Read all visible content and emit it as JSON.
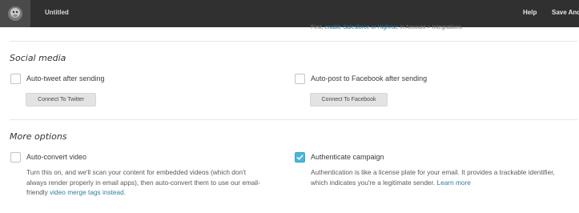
{
  "topbar": {
    "logo": "chimp-logo-icon",
    "title": "Untitled",
    "help_label": "Help",
    "save_label": "Save And"
  },
  "hint": {
    "prefix": "First, ",
    "link": "enable Salesforce or Highrise",
    "suffix": " in Account > Integrations."
  },
  "social": {
    "heading": "Social media",
    "twitter": {
      "checked": false,
      "label": "Auto-tweet after sending",
      "button": "Connect To Twitter"
    },
    "facebook": {
      "checked": false,
      "label": "Auto-post to Facebook after sending",
      "button": "Connect To Facebook"
    }
  },
  "more": {
    "heading": "More options",
    "video": {
      "checked": false,
      "label": "Auto-convert video",
      "desc_line1": "Turn this on, and we'll scan your content for embedded videos (which don't",
      "desc_line2": "always render properly in email apps), then auto-convert them to use our email-",
      "desc_line3_prefix": "friendly ",
      "desc_link": "video merge tags instead."
    },
    "authenticate": {
      "checked": true,
      "label": "Authenticate campaign",
      "desc_line1": "Authentication is like a license plate for your email. It provides a trackable identifier,",
      "desc_line2_prefix": "which indicates you're a legitimate sender. ",
      "desc_link": "Learn more"
    }
  },
  "colors": {
    "topbar_bg": "#303030",
    "link": "#2d7fa1",
    "checkbox_checked": "#4db6d6"
  }
}
